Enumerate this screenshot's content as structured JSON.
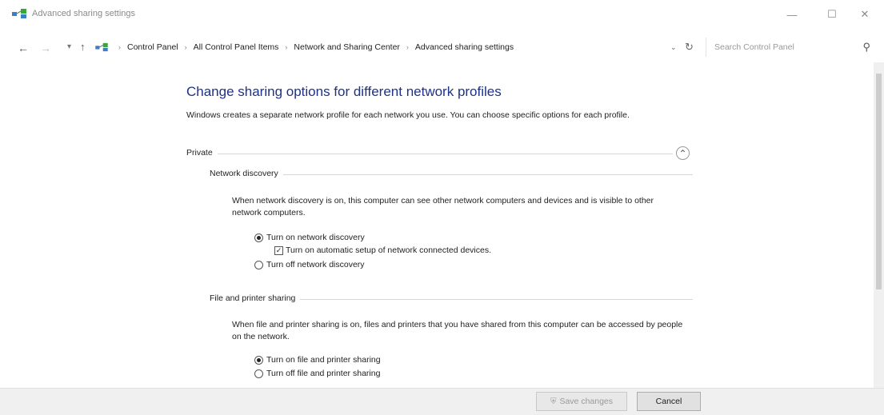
{
  "window": {
    "title": "Advanced sharing settings",
    "minimize_glyph": "—",
    "maximize_glyph": "☐",
    "close_glyph": "✕"
  },
  "nav": {
    "back_glyph": "←",
    "forward_glyph": "→",
    "recent_glyph": "▾",
    "up_glyph": "↑",
    "breadcrumbs": [
      "Control Panel",
      "All Control Panel Items",
      "Network and Sharing Center",
      "Advanced sharing settings"
    ],
    "separator": "›",
    "dropdown_glyph": "⌄",
    "refresh_glyph": "↻",
    "search_placeholder": "Search Control Panel",
    "search_glyph": "⚲"
  },
  "main": {
    "heading": "Change sharing options for different network profiles",
    "description": "Windows creates a separate network profile for each network you use. You can choose specific options for each profile.",
    "profile": {
      "label": "Private",
      "collapse_glyph": "⌃"
    },
    "network_discovery": {
      "label": "Network discovery",
      "description": "When network discovery is on, this computer can see other network computers and devices and is visible to other network computers.",
      "option_on": "Turn on network discovery",
      "option_auto": "Turn on automatic setup of network connected devices.",
      "option_off": "Turn off network discovery",
      "selected": "on",
      "auto_checked": true
    },
    "file_printer_sharing": {
      "label": "File and printer sharing",
      "description": "When file and printer sharing is on, files and printers that you have shared from this computer can be accessed by people on the network.",
      "option_on": "Turn on file and printer sharing",
      "option_off": "Turn off file and printer sharing",
      "selected": "on"
    }
  },
  "footer": {
    "save_label": "Save changes",
    "cancel_label": "Cancel"
  },
  "colors": {
    "heading": "#1e3287",
    "footer_bg": "#f0f0f0"
  }
}
